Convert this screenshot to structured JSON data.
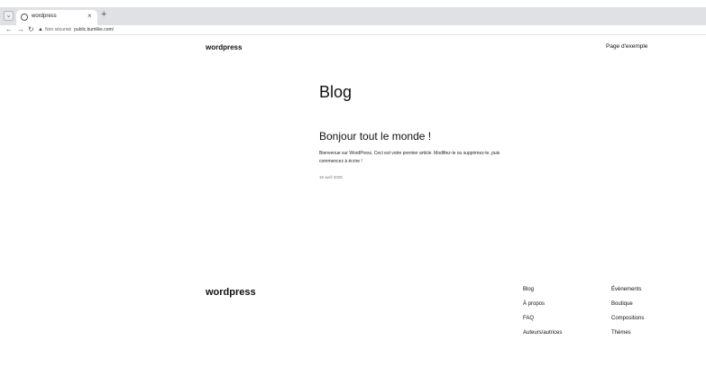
{
  "browser": {
    "tab_title": "wordpress",
    "tab_close": "×",
    "new_tab": "+",
    "tab_dropdown": "⌄",
    "back": "←",
    "forward": "→",
    "reload": "↻",
    "security_label": "Non sécurisé",
    "url": "public.bumlike.com/"
  },
  "header": {
    "site_title": "wordpress",
    "nav_link": "Page d'exemple"
  },
  "main": {
    "heading": "Blog",
    "post": {
      "title": "Bonjour tout le monde !",
      "excerpt": "Bienvenue sur WordPress. Ceci est votre premier article. Modifiez-le ou supprimez-le, puis commencez à écrire !",
      "date": "15 avril 2025"
    }
  },
  "footer": {
    "site_title": "wordpress",
    "col1": [
      "Blog",
      "À propos",
      "FAQ",
      "Auteurs/autrices"
    ],
    "col2": [
      "Évènements",
      "Boutique",
      "Compositions",
      "Thèmes"
    ]
  }
}
